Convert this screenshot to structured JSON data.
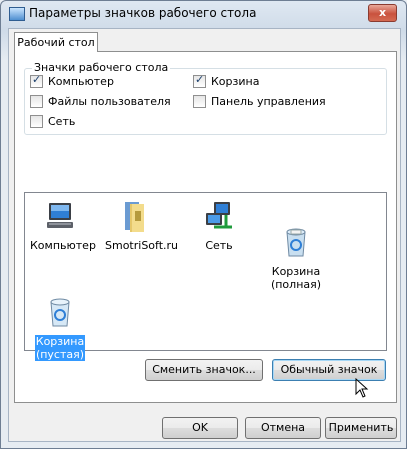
{
  "window": {
    "title": "Параметры значков рабочего стола",
    "close_label": "x"
  },
  "tabs": [
    {
      "label": "Рабочий стол"
    }
  ],
  "desktop_icons_group": {
    "title": "Значки рабочего стола",
    "checkboxes": [
      {
        "label": "Компьютер",
        "checked": true
      },
      {
        "label": "Корзина",
        "checked": true
      },
      {
        "label": "Файлы пользователя",
        "checked": false
      },
      {
        "label": "Панель управления",
        "checked": false
      },
      {
        "label": "Сеть",
        "checked": false
      }
    ]
  },
  "icon_list": [
    {
      "label": "Компьютер",
      "icon": "computer-icon"
    },
    {
      "label": "SmotriSoft.ru",
      "icon": "user-folder-icon"
    },
    {
      "label": "Сеть",
      "icon": "network-icon"
    },
    {
      "label": "Корзина\n(полная)",
      "icon": "recycle-bin-full-icon"
    },
    {
      "label": "Корзина\n(пустая)",
      "icon": "recycle-bin-empty-icon",
      "selected": true
    }
  ],
  "buttons": {
    "change_icon": "Сменить значок...",
    "default_icon": "Обычный значок",
    "ok": "OK",
    "cancel": "Отмена",
    "apply": "Применить"
  }
}
